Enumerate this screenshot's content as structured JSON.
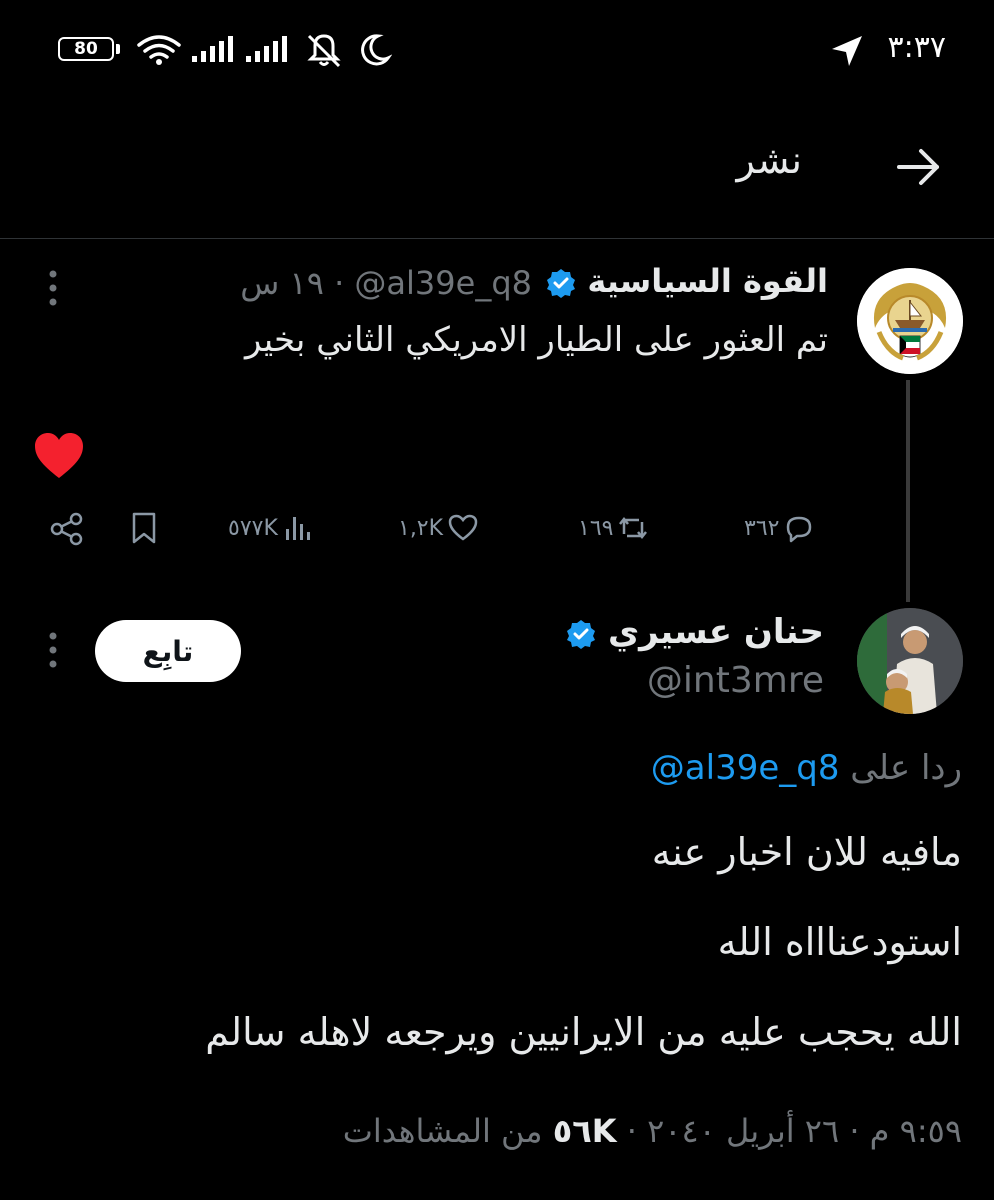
{
  "status_bar": {
    "battery": "80",
    "time": "٣:٣٧"
  },
  "header": {
    "title": "نشر"
  },
  "tweet": {
    "author_name": "القوة السياسية",
    "handle": "@al39e_q8",
    "separator": "·",
    "time_ago": "١٩ س",
    "text": "تم العثور على الطيار الامريكي الثاني بخير",
    "stats": {
      "replies": "٣٦٢",
      "retweets": "١٦٩",
      "likes": "١,٢K",
      "views": "٥٧٧K"
    }
  },
  "reply": {
    "author_name": "حنان عسيري",
    "handle": "@int3mre",
    "follow_label": "تابِع",
    "reply_prefix": "ردا على",
    "reply_mention": "@al39e_q8",
    "lines": [
      "مافيه للان اخبار عنه",
      "استودعناااه الله",
      "الله يحجب عليه من الايرانيين ويرجعه لاهله سالم"
    ],
    "footer": {
      "time": "٩:٥٩ م",
      "date": "٢٦ أبريل ٢٠٤٠",
      "views_count": "٥٦K",
      "views_label": "من المشاهدات"
    }
  },
  "colors": {
    "background": "#000000",
    "text": "#e7e9ea",
    "muted": "#71767b",
    "accent": "#1d9bf0",
    "like_red": "#f4212e"
  },
  "icons": [
    "battery-icon",
    "wifi-icon",
    "signal-icon",
    "signal-icon-2",
    "mute-icon",
    "moon-icon",
    "location-arrow-icon",
    "back-arrow-icon",
    "verified-badge-icon",
    "more-dots-icon",
    "heart-filled-icon",
    "reply-icon",
    "retweet-icon",
    "like-icon",
    "views-icon",
    "bookmark-icon",
    "share-icon"
  ]
}
